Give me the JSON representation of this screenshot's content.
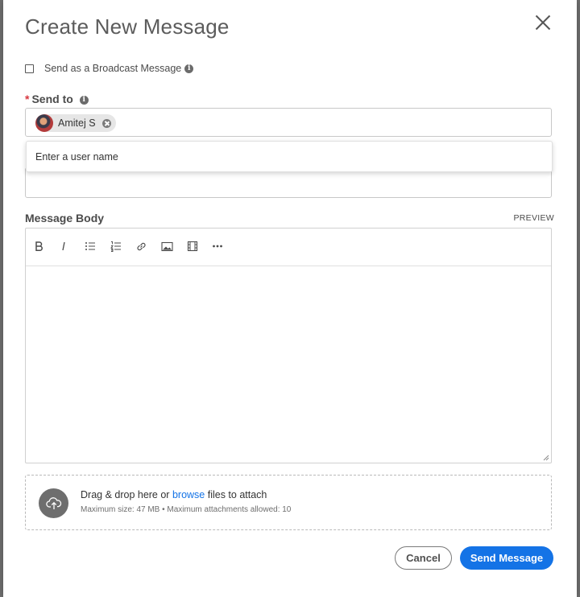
{
  "dialog": {
    "title": "Create New Message"
  },
  "broadcast": {
    "label": "Send as a Broadcast Message",
    "checked": false
  },
  "send_to": {
    "required_marker": "*",
    "label": "Send to",
    "recipients": [
      {
        "name": "Amitej S"
      }
    ]
  },
  "autocomplete": {
    "hint": "Enter a user name"
  },
  "message_body": {
    "label": "Message Body",
    "preview_label": "PREVIEW",
    "toolbar": [
      "bold",
      "italic",
      "bulleted-list",
      "numbered-list",
      "link",
      "image",
      "video",
      "more"
    ]
  },
  "attachments": {
    "prefix": "Drag & drop here or ",
    "browse": "browse",
    "suffix": " files to attach",
    "limits": "Maximum size: 47 MB • Maximum attachments allowed: 10"
  },
  "actions": {
    "cancel_label": "Cancel",
    "send_label": "Send Message"
  },
  "colors": {
    "accent": "#1473e6",
    "required": "#d7373f"
  }
}
